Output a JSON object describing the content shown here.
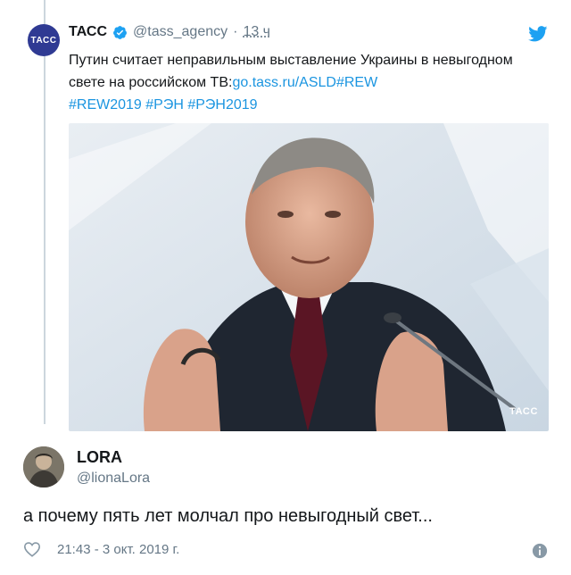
{
  "quoted_tweet": {
    "avatar_text": "ТАСС",
    "name": "ТАСС",
    "handle": "@tass_agency",
    "separator": "·",
    "time": "13 ч",
    "text_plain": "Путин считает неправильным выставление Украины в невыгодном свете на российском ТВ:",
    "text_link": "go.tass.ru/ASLD",
    "hashtags_line1": "#REW",
    "hashtags_line2": "#REW2019 #РЭН #РЭН2019",
    "image_watermark": "ТАСС"
  },
  "reply": {
    "name": "LORA",
    "handle": "@lionaLora",
    "text": "а почему пять лет молчал про невыгодный свет...",
    "timestamp": "21:43 - 3 окт. 2019 г."
  },
  "icons": {
    "verified": "verified-badge-icon",
    "twitter": "twitter-bird-icon",
    "like": "heart-icon",
    "info": "info-icon"
  },
  "colors": {
    "link": "#1b95e0",
    "tass_brand": "#2f3a93",
    "twitter_blue": "#1da1f2",
    "secondary_text": "#657786"
  }
}
